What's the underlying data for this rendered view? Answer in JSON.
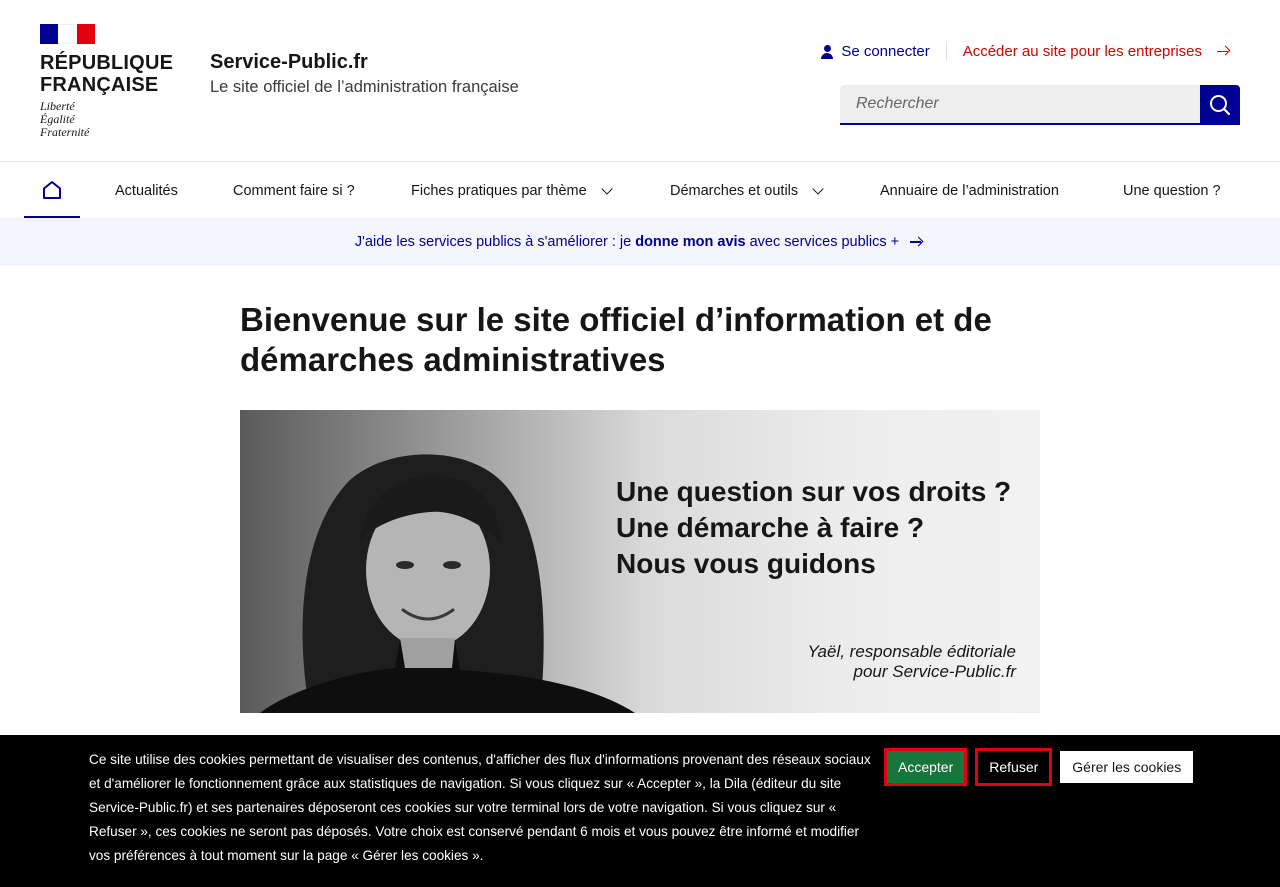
{
  "header": {
    "rf_title_line1": "RÉPUBLIQUE",
    "rf_title_line2": "FRANÇAISE",
    "motto_1": "Liberté",
    "motto_2": "Égalité",
    "motto_3": "Fraternité",
    "site_name": "Service-Public.fr",
    "site_tagline": "Le site officiel de l’administration française",
    "login_label": "Se connecter",
    "business_link": "Accéder au site pour les entreprises",
    "search_placeholder": "Rechercher"
  },
  "nav": {
    "home_icon": "home-icon",
    "items": [
      {
        "label": "Actualités"
      },
      {
        "label": "Comment faire si ?"
      },
      {
        "label": "Fiches pratiques par thème"
      },
      {
        "label": "Démarches et outils"
      },
      {
        "label": "Annuaire de l’administration"
      },
      {
        "label": "Une question ?"
      }
    ]
  },
  "notice": {
    "prefix": "J'aide les services publics à s'améliorer : je",
    "bold": "donne mon avis",
    "suffix": "avec services publics +"
  },
  "main": {
    "title": "Bienvenue sur le site officiel d’information et de démarches administratives",
    "hero_line1": "Une question sur vos droits ?",
    "hero_line2": "Une démarche à faire ?",
    "hero_line3": "Nous vous guidons",
    "hero_caption_1": "Yaël, responsable éditoriale",
    "hero_caption_2": "pour Service-Public.fr"
  },
  "cookie": {
    "text": "Ce site utilise des cookies permettant de visualiser des contenus, d'afficher des flux d'informations provenant des réseaux sociaux et d'améliorer le fonctionnement grâce aux statistiques de navigation. Si vous cliquez sur « Accepter », la Dila (éditeur du site Service-Public.fr) et ses partenaires déposeront ces cookies sur votre terminal lors de votre navigation. Si vous cliquez sur « Refuser », ces cookies ne seront pas déposés. Votre choix est conservé pendant 6 mois et vous pouvez être informé et modifier vos préférences à tout moment sur la page « Gérer les cookies ».",
    "accept": "Accepter",
    "refuse": "Refuser",
    "manage": "Gérer les cookies"
  },
  "colors": {
    "blue_france": "#000091",
    "red_marianne": "#e1000f",
    "accept_green": "#18753c",
    "notice_bg": "#f5f5fe"
  }
}
